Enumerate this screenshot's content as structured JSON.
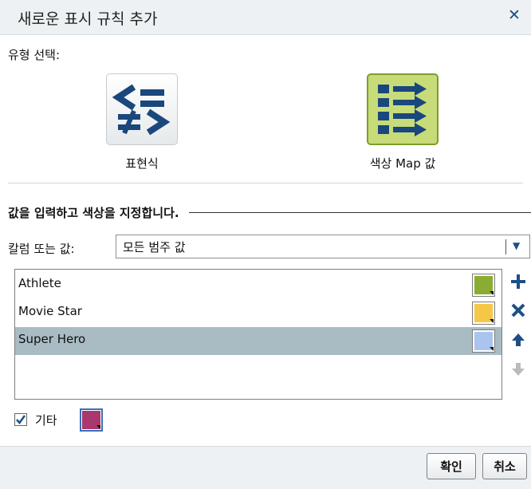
{
  "dialog": {
    "title": "새로운 표시 규칙 추가",
    "close_icon": "close-icon"
  },
  "type_select": {
    "label": "유형 선택:",
    "options": [
      {
        "caption": "표현식",
        "icon": "expression-icon",
        "selected": false
      },
      {
        "caption": "색상 Map 값",
        "icon": "color-map-icon",
        "selected": true
      }
    ]
  },
  "values_section": {
    "heading": "값을 입력하고 색상을 지정합니다.",
    "column_label": "칼럼 또는 값:",
    "column_value": "모든 범주 값",
    "items": [
      {
        "label": "Athlete",
        "color": "#8aac32",
        "selected": false
      },
      {
        "label": "Movie Star",
        "color": "#f6c746",
        "selected": false
      },
      {
        "label": "Super Hero",
        "color": "#a9c4ee",
        "selected": true
      }
    ],
    "side_buttons": [
      "add-icon",
      "delete-icon",
      "move-up-icon",
      "move-down-icon"
    ]
  },
  "other": {
    "label": "기타",
    "checked": true,
    "color": "#a8386e"
  },
  "footer": {
    "ok_label": "확인",
    "cancel_label": "취소"
  },
  "colors": {
    "accent": "#1d4f86",
    "selection": "#a9bcc4",
    "title_bar": "#edf1f3"
  }
}
